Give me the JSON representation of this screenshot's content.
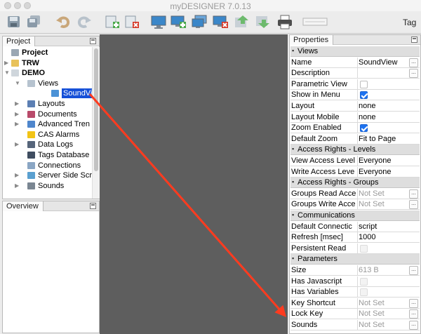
{
  "window": {
    "title": "myDESIGNER 7.0.13"
  },
  "toolbar": {
    "buttons": [
      "save-icon",
      "save-all-icon",
      "undo-icon",
      "redo-icon",
      "add-screen-icon",
      "delete-screen-icon",
      "monitor-icon",
      "monitor-add-icon",
      "monitor-duplicate-icon",
      "monitor-delete-icon",
      "move-up-icon",
      "move-down-icon",
      "print-icon",
      "tag-icon"
    ],
    "tag_label": "Tag"
  },
  "project_panel": {
    "tab": "Project",
    "tree": [
      {
        "label": "Project",
        "icon": "project-icon",
        "bold": true,
        "level": 0,
        "arrow": ""
      },
      {
        "label": "TRW",
        "icon": "folder-icon",
        "bold": true,
        "level": 0,
        "arrow": "▶"
      },
      {
        "label": "DEMO",
        "icon": "folder-open-icon",
        "bold": true,
        "level": 0,
        "arrow": "▼"
      },
      {
        "label": "Views",
        "icon": "views-icon",
        "bold": false,
        "level": 1,
        "arrow": "▼"
      },
      {
        "label": "SoundView",
        "icon": "view-icon",
        "bold": false,
        "level": 2,
        "arrow": "",
        "selected": true
      },
      {
        "label": "Layouts",
        "icon": "layouts-icon",
        "bold": false,
        "level": 1,
        "arrow": "▶"
      },
      {
        "label": "Documents",
        "icon": "documents-icon",
        "bold": false,
        "level": 1,
        "arrow": "▶"
      },
      {
        "label": "Advanced Tren",
        "icon": "trend-icon",
        "bold": false,
        "level": 1,
        "arrow": "▶"
      },
      {
        "label": "CAS Alarms",
        "icon": "alarm-bell-icon",
        "bold": false,
        "level": 1,
        "arrow": ""
      },
      {
        "label": "Data Logs",
        "icon": "data-logs-icon",
        "bold": false,
        "level": 1,
        "arrow": "▶"
      },
      {
        "label": "Tags Database",
        "icon": "tags-database-icon",
        "bold": false,
        "level": 1,
        "arrow": ""
      },
      {
        "label": "Connections",
        "icon": "connections-icon",
        "bold": false,
        "level": 1,
        "arrow": ""
      },
      {
        "label": "Server Side Scri",
        "icon": "script-icon",
        "bold": false,
        "level": 1,
        "arrow": "▶"
      },
      {
        "label": "Sounds",
        "icon": "sounds-icon",
        "bold": false,
        "level": 1,
        "arrow": "▶"
      }
    ]
  },
  "overview_panel": {
    "tab": "Overview"
  },
  "properties_panel": {
    "tab": "Properties",
    "rows": [
      {
        "kind": "group",
        "label": "Views"
      },
      {
        "kind": "prop",
        "name": "Name",
        "value": "SoundView",
        "ellipsis": true
      },
      {
        "kind": "prop",
        "name": "Description",
        "value": "",
        "ellipsis": true
      },
      {
        "kind": "prop",
        "name": "Parametric View",
        "checkbox": "off"
      },
      {
        "kind": "prop",
        "name": "Show in Menu",
        "checkbox": "on"
      },
      {
        "kind": "prop",
        "name": "Layout",
        "value": "none"
      },
      {
        "kind": "prop",
        "name": "Layout Mobile",
        "value": "none"
      },
      {
        "kind": "prop",
        "name": "Zoom Enabled",
        "checkbox": "on"
      },
      {
        "kind": "prop",
        "name": "Default Zoom",
        "value": "Fit to Page"
      },
      {
        "kind": "group",
        "label": "Access Rights - Levels"
      },
      {
        "kind": "prop",
        "name": "View Access Level",
        "value": "Everyone"
      },
      {
        "kind": "prop",
        "name": "Write Access Leve",
        "value": "Everyone"
      },
      {
        "kind": "group",
        "label": "Access Rights - Groups"
      },
      {
        "kind": "prop",
        "name": "Groups Read Acce",
        "value": "Not Set",
        "gray": true,
        "ellipsis": true
      },
      {
        "kind": "prop",
        "name": "Groups Write Acce",
        "value": "Not Set",
        "gray": true,
        "ellipsis": true
      },
      {
        "kind": "group",
        "label": "Communications"
      },
      {
        "kind": "prop",
        "name": "Default Connectic",
        "value": "script"
      },
      {
        "kind": "prop",
        "name": "Refresh [msec]",
        "value": "1000"
      },
      {
        "kind": "prop",
        "name": "Persistent Read",
        "checkbox": "disabled"
      },
      {
        "kind": "group",
        "label": "Parameters"
      },
      {
        "kind": "prop",
        "name": "Size",
        "value": "613 B",
        "gray": true,
        "ellipsis": true
      },
      {
        "kind": "prop",
        "name": "Has Javascript",
        "checkbox": "disabled"
      },
      {
        "kind": "prop",
        "name": "Has Variables",
        "checkbox": "disabled"
      },
      {
        "kind": "prop",
        "name": "Key Shortcut",
        "value": "Not Set",
        "gray": true,
        "ellipsis": true
      },
      {
        "kind": "prop",
        "name": "Lock Key",
        "value": "Not Set",
        "gray": true,
        "ellipsis": true
      },
      {
        "kind": "prop",
        "name": "Sounds",
        "value": "Not Set",
        "gray": true,
        "ellipsis": true
      }
    ]
  },
  "annotation": {
    "color": "#ff3b1f"
  }
}
